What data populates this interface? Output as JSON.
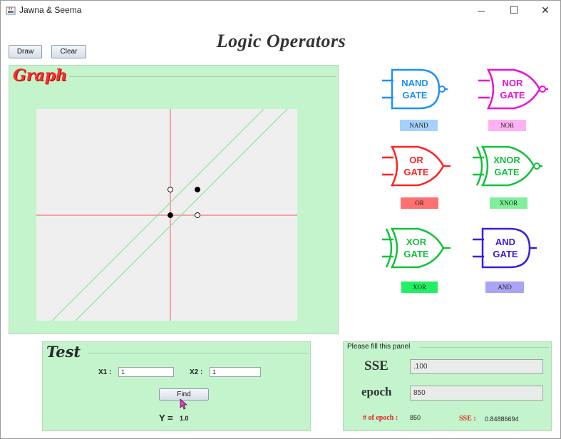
{
  "window": {
    "title": "Jawna & Seema",
    "minimize_glyph": "—",
    "maximize_glyph": "☐",
    "close_glyph": "✕"
  },
  "main_title": "Logic Operators",
  "toolbar": {
    "draw_label": "Draw",
    "clear_label": "Clear"
  },
  "graph_panel": {
    "title": "Graph",
    "points": [
      {
        "x": 0,
        "y": 0,
        "filled": true
      },
      {
        "x": 0,
        "y": 1,
        "filled": false
      },
      {
        "x": 1,
        "y": 0,
        "filled": false
      },
      {
        "x": 1,
        "y": 1,
        "filled": true
      }
    ]
  },
  "gates": [
    {
      "id": "nand",
      "line1": "NAND",
      "line2": "GATE",
      "color": "#1e90ff",
      "button_label": "NAND",
      "button_color": "#a5d1ff"
    },
    {
      "id": "nor",
      "line1": "NOR",
      "line2": "GATE",
      "color": "#ee10d4",
      "button_label": "NOR",
      "button_color": "#ffb1f3"
    },
    {
      "id": "or",
      "line1": "OR",
      "line2": "GATE",
      "color": "#ff2222",
      "button_label": "OR",
      "button_color": "#ff7070"
    },
    {
      "id": "xnor",
      "line1": "XNOR",
      "line2": "GATE",
      "color": "#12c13c",
      "button_label": "XNOR",
      "button_color": "#7ff09a"
    },
    {
      "id": "xor",
      "line1": "XOR",
      "line2": "GATE",
      "color": "#12c13c",
      "button_label": "XOR",
      "button_color": "#21f064"
    },
    {
      "id": "and",
      "line1": "AND",
      "line2": "GATE",
      "color": "#3a1ee0",
      "button_label": "AND",
      "button_color": "#a9a4f4"
    }
  ],
  "test_panel": {
    "title": "Test",
    "x1_label": "X1 :",
    "x1_value": "1",
    "x2_label": "X2 :",
    "x2_value": "1",
    "find_label": "Find",
    "y_label": "Y =",
    "y_value": "1.0"
  },
  "params_panel": {
    "title": "Please fill this panel",
    "sse_label": "SSE",
    "sse_value": ".100",
    "epoch_label": "epoch",
    "epoch_value": "850",
    "num_epoch_label": "# of epoch :",
    "num_epoch_value": "850",
    "sse_result_label": "SSE :",
    "sse_result_value": "0.84886694"
  },
  "colors": {
    "panel_bg": "#c3f4cc",
    "graph_title": "#ff2a2a",
    "axis": "#ff4444",
    "decision_lines": "#7ee38c",
    "result_label": "#e02020"
  }
}
